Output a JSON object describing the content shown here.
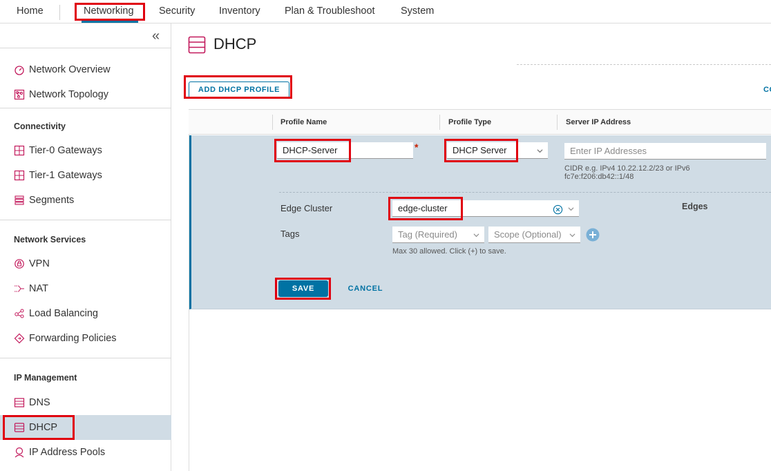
{
  "nav": {
    "items": [
      {
        "label": "Home"
      },
      {
        "label": "Networking"
      },
      {
        "label": "Security"
      },
      {
        "label": "Inventory"
      },
      {
        "label": "Plan & Troubleshoot"
      },
      {
        "label": "System"
      }
    ],
    "active": "Networking"
  },
  "sidebar": {
    "collapse_glyph": "«",
    "top_items": [
      {
        "label": "Network Overview",
        "icon": "gauge-icon"
      },
      {
        "label": "Network Topology",
        "icon": "topology-icon"
      }
    ],
    "sections": [
      {
        "heading": "Connectivity",
        "items": [
          {
            "label": "Tier-0 Gateways",
            "icon": "gateway-icon"
          },
          {
            "label": "Tier-1 Gateways",
            "icon": "gateway-icon"
          },
          {
            "label": "Segments",
            "icon": "segments-icon"
          }
        ]
      },
      {
        "heading": "Network Services",
        "items": [
          {
            "label": "VPN",
            "icon": "vpn-icon"
          },
          {
            "label": "NAT",
            "icon": "nat-icon"
          },
          {
            "label": "Load Balancing",
            "icon": "load-balancer-icon"
          },
          {
            "label": "Forwarding Policies",
            "icon": "forwarding-icon"
          }
        ]
      },
      {
        "heading": "IP Management",
        "items": [
          {
            "label": "DNS",
            "icon": "dns-icon"
          },
          {
            "label": "DHCP",
            "icon": "dhcp-icon",
            "active": true
          },
          {
            "label": "IP Address Pools",
            "icon": "ip-pool-icon"
          }
        ]
      }
    ]
  },
  "page": {
    "title": "DHCP",
    "add_button": "ADD DHCP PROFILE",
    "right_cut_text": "CO"
  },
  "grid": {
    "columns": [
      "Profile Name",
      "Profile Type",
      "Server IP Address"
    ]
  },
  "form": {
    "profile_name": "DHCP-Server",
    "required_marker": "*",
    "profile_type": "DHCP Server",
    "server_ip_placeholder": "Enter IP Addresses",
    "server_ip_hint_1": "CIDR e.g. IPv4 10.22.12.2/23 or IPv6",
    "server_ip_hint_2": "fc7e:f206:db42::1/48",
    "edge_cluster_label": "Edge Cluster",
    "edge_cluster_value": "edge-cluster",
    "edges_label": "Edges",
    "tags_label": "Tags",
    "tag_placeholder": "Tag (Required)",
    "scope_placeholder": "Scope (Optional)",
    "tags_hint": "Max 30 allowed. Click (+) to save.",
    "save_label": "SAVE",
    "cancel_label": "CANCEL"
  },
  "colors": {
    "accent": "#0072a3",
    "highlight": "#e0000f",
    "edit_row_bg": "#d0dce5",
    "icon_pink": "#c2185b"
  }
}
